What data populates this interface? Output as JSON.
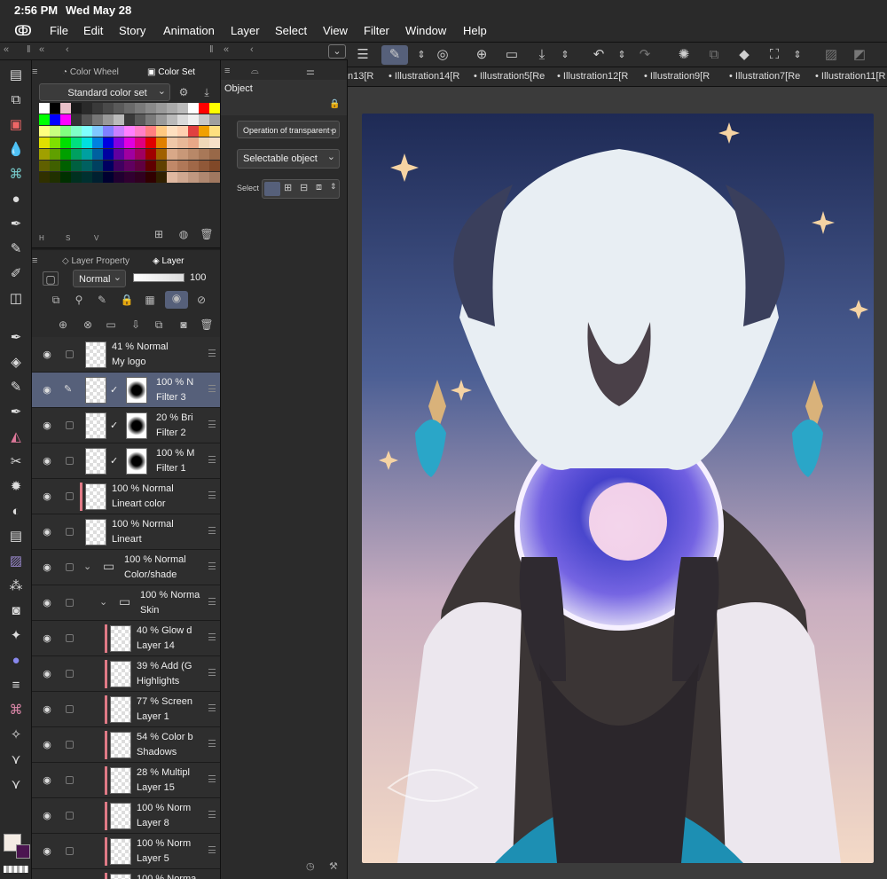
{
  "status": {
    "time": "2:56 PM",
    "date": "Wed May 28"
  },
  "menu": [
    "File",
    "Edit",
    "Story",
    "Animation",
    "Layer",
    "Select",
    "View",
    "Filter",
    "Window",
    "Help"
  ],
  "doc_tabs": [
    "n13[R",
    "Illustration14[R",
    "Illustration5[Re",
    "Illustration12[R",
    "Illustration9[R",
    "Illustration7[Re",
    "Illustration11[R"
  ],
  "color_panel": {
    "tabs": [
      "Color Wheel",
      "Color Set"
    ],
    "set_name": "Standard color set",
    "hsv_labels": [
      "H",
      "S",
      "V"
    ]
  },
  "layer_panel": {
    "tabs": [
      "Layer Property",
      "Layer"
    ],
    "blend_mode": "Normal",
    "opacity": "100",
    "layers": [
      {
        "pct": "41 %",
        "mode": "Normal",
        "name": "My logo",
        "selected": false
      },
      {
        "pct": "100 %",
        "mode": "N",
        "name": "Filter 3",
        "selected": true
      },
      {
        "pct": "20 %",
        "mode": "Bri",
        "name": "Filter 2",
        "selected": false
      },
      {
        "pct": "100 %",
        "mode": "M",
        "name": "Filter 1",
        "selected": false
      },
      {
        "pct": "100 %",
        "mode": "Normal",
        "name": "Lineart color",
        "selected": false
      },
      {
        "pct": "100 %",
        "mode": "Normal",
        "name": "Lineart",
        "selected": false
      },
      {
        "pct": "100 %",
        "mode": "Normal",
        "name": "Color/shade",
        "selected": false
      },
      {
        "pct": "100 %",
        "mode": "Norma",
        "name": "Skin",
        "selected": false
      },
      {
        "pct": "40 %",
        "mode": "Glow d",
        "name": "Layer 14",
        "selected": false
      },
      {
        "pct": "39 %",
        "mode": "Add (G",
        "name": "Highlights",
        "selected": false
      },
      {
        "pct": "77 %",
        "mode": "Screen",
        "name": "Layer 1",
        "selected": false
      },
      {
        "pct": "54 %",
        "mode": "Color b",
        "name": "Shadows",
        "selected": false
      },
      {
        "pct": "28 %",
        "mode": "Multipl",
        "name": "Layer 15",
        "selected": false
      },
      {
        "pct": "100 %",
        "mode": "Norm",
        "name": "Layer 8",
        "selected": false
      },
      {
        "pct": "100 %",
        "mode": "Norm",
        "name": "Layer 5",
        "selected": false
      },
      {
        "pct": "100 %",
        "mode": "Norma",
        "name": "",
        "selected": false
      }
    ]
  },
  "object_panel": {
    "title": "Object",
    "transparent_op": "Operation of transparent p",
    "selectable": "Selectable object",
    "select_label": "Select"
  }
}
